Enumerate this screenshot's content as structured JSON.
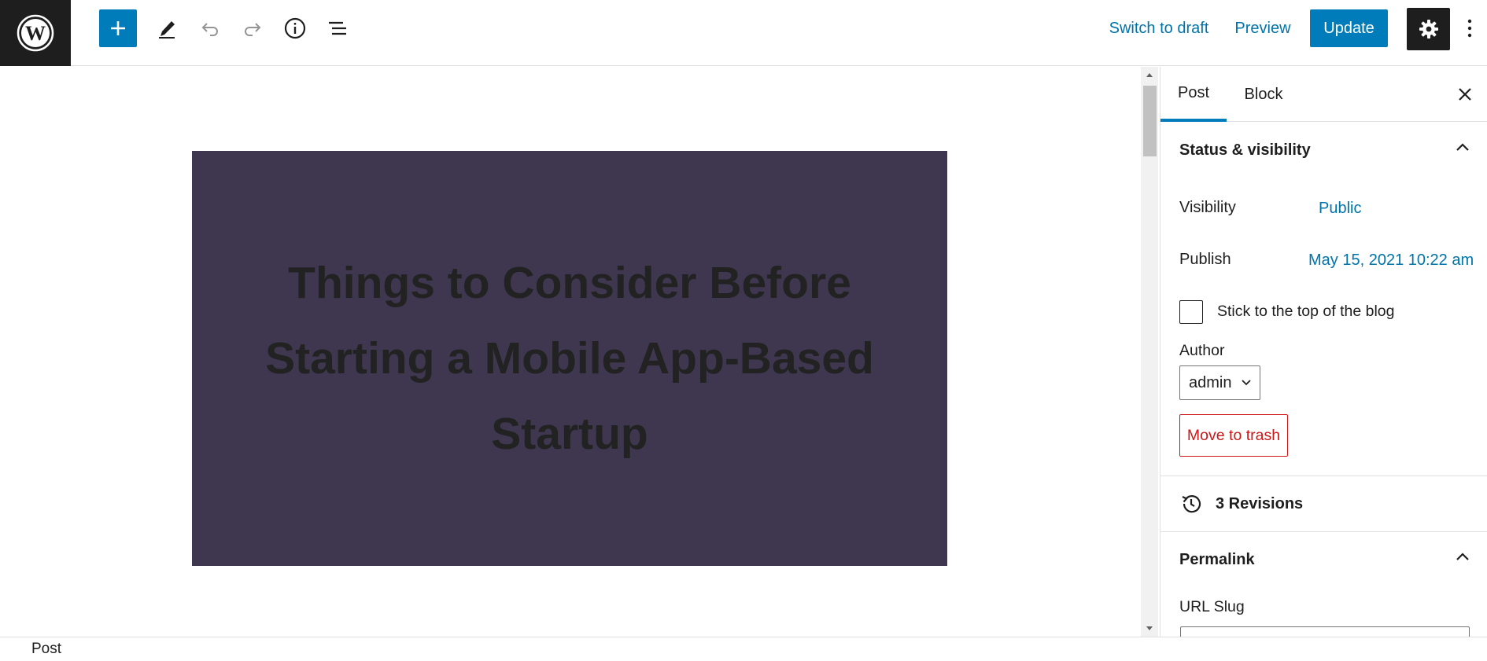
{
  "toolbar": {
    "logo_icon": "wordpress-logo-icon",
    "add_icon": "plus-icon",
    "tools_icon": "pencil-icon",
    "undo_icon": "undo-icon",
    "redo_icon": "redo-icon",
    "details_icon": "info-icon",
    "list_view_icon": "list-view-icon",
    "switch_to_draft_label": "Switch to draft",
    "preview_label": "Preview",
    "update_label": "Update",
    "settings_icon": "gear-icon",
    "more_icon": "more-vertical-icon",
    "accent_color": "#007cba"
  },
  "editor": {
    "cover_title": "Things to Consider Before Starting a Mobile App-Based Startup",
    "cover_overlay_color": "#3f374f"
  },
  "sidebar": {
    "tabs": [
      {
        "label": "Post",
        "active": true
      },
      {
        "label": "Block",
        "active": false
      }
    ],
    "status_visibility": {
      "heading": "Status & visibility",
      "visibility_label": "Visibility",
      "visibility_value": "Public",
      "publish_label": "Publish",
      "publish_value": "May 15, 2021 10:22 am",
      "sticky_label": "Stick to the top of the blog",
      "sticky_checked": false,
      "author_label": "Author",
      "author_value": "admin",
      "trash_label": "Move to trash"
    },
    "revisions": {
      "label": "3 Revisions"
    },
    "permalink": {
      "heading": "Permalink",
      "url_slug_label": "URL Slug",
      "url_slug_value": ""
    }
  },
  "footer": {
    "breadcrumb": "Post"
  }
}
